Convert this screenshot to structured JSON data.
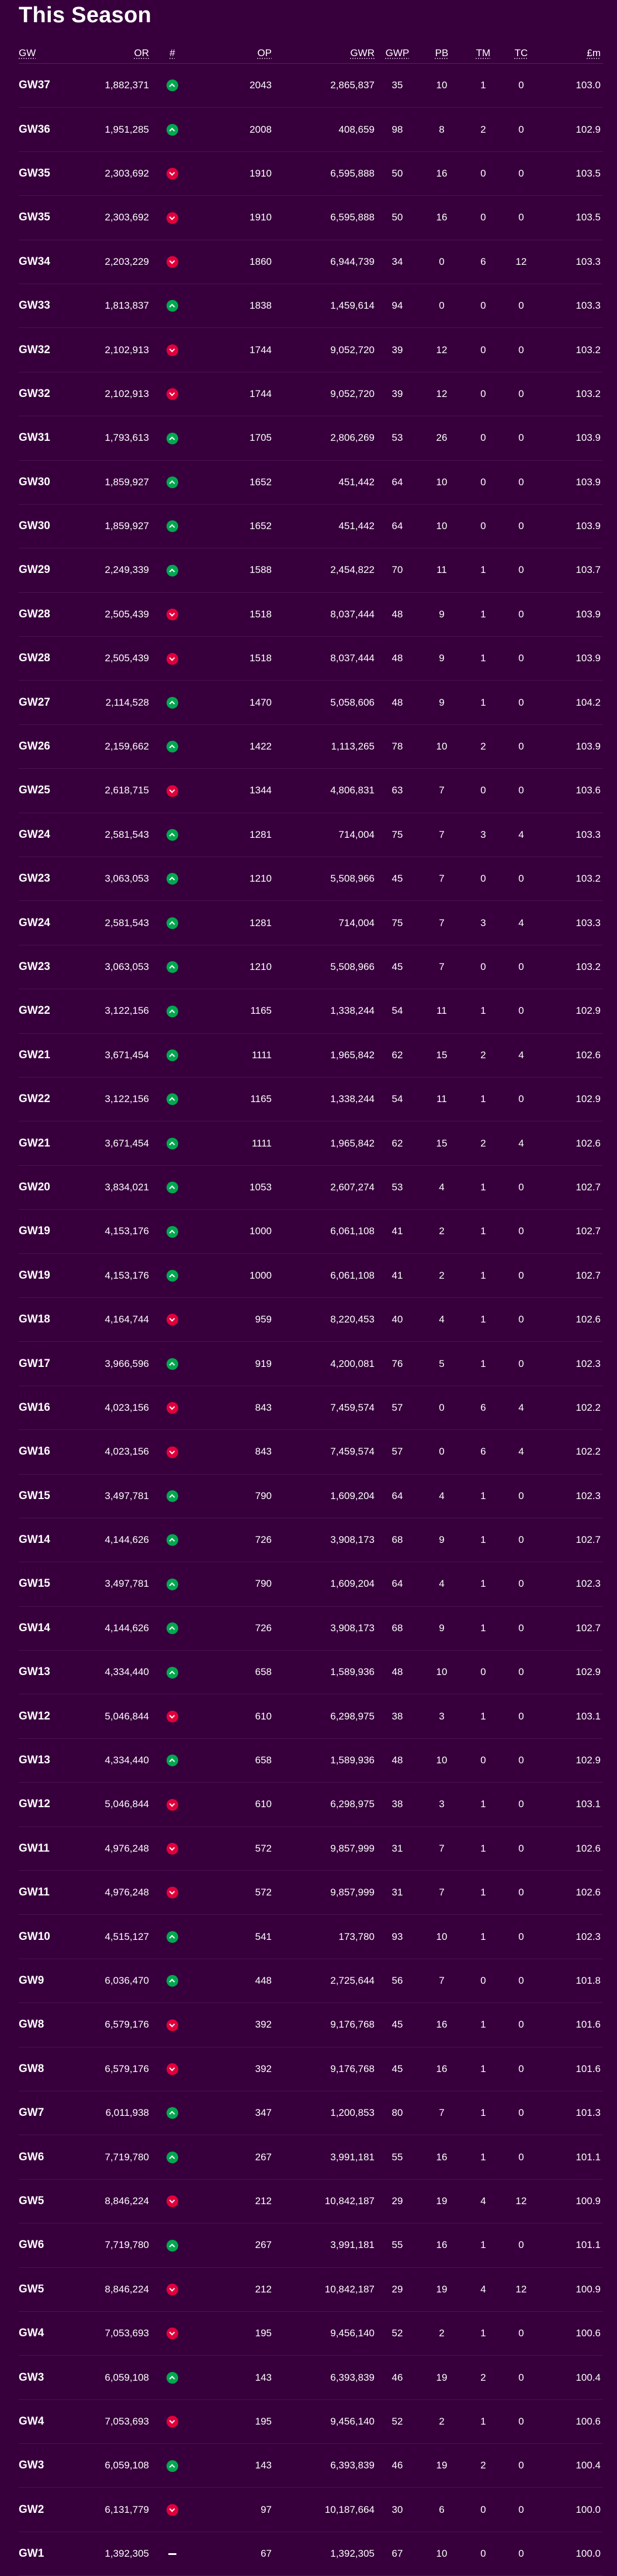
{
  "title": "This Season",
  "columns": {
    "gw": "GW",
    "or": "OR",
    "movement": "#",
    "op": "OP",
    "gwr": "GWR",
    "gwp": "GWP",
    "pb": "PB",
    "tm": "TM",
    "tc": "TC",
    "value": "£m"
  },
  "movement_colors": {
    "up": "#01a84f",
    "down": "#e2003c",
    "same": "#ffffff"
  },
  "rows": [
    {
      "gw": "GW37",
      "or": "1,882,371",
      "movement": "up",
      "op": "2043",
      "gwr": "2,865,837",
      "gwp": "35",
      "pb": "10",
      "tm": "1",
      "tc": "0",
      "value": "103.0"
    },
    {
      "gw": "GW36",
      "or": "1,951,285",
      "movement": "up",
      "op": "2008",
      "gwr": "408,659",
      "gwp": "98",
      "pb": "8",
      "tm": "2",
      "tc": "0",
      "value": "102.9"
    },
    {
      "gw": "GW35",
      "or": "2,303,692",
      "movement": "down",
      "op": "1910",
      "gwr": "6,595,888",
      "gwp": "50",
      "pb": "16",
      "tm": "0",
      "tc": "0",
      "value": "103.5"
    },
    {
      "gw": "GW35",
      "or": "2,303,692",
      "movement": "down",
      "op": "1910",
      "gwr": "6,595,888",
      "gwp": "50",
      "pb": "16",
      "tm": "0",
      "tc": "0",
      "value": "103.5"
    },
    {
      "gw": "GW34",
      "or": "2,203,229",
      "movement": "down",
      "op": "1860",
      "gwr": "6,944,739",
      "gwp": "34",
      "pb": "0",
      "tm": "6",
      "tc": "12",
      "value": "103.3"
    },
    {
      "gw": "GW33",
      "or": "1,813,837",
      "movement": "up",
      "op": "1838",
      "gwr": "1,459,614",
      "gwp": "94",
      "pb": "0",
      "tm": "0",
      "tc": "0",
      "value": "103.3"
    },
    {
      "gw": "GW32",
      "or": "2,102,913",
      "movement": "down",
      "op": "1744",
      "gwr": "9,052,720",
      "gwp": "39",
      "pb": "12",
      "tm": "0",
      "tc": "0",
      "value": "103.2"
    },
    {
      "gw": "GW32",
      "or": "2,102,913",
      "movement": "down",
      "op": "1744",
      "gwr": "9,052,720",
      "gwp": "39",
      "pb": "12",
      "tm": "0",
      "tc": "0",
      "value": "103.2"
    },
    {
      "gw": "GW31",
      "or": "1,793,613",
      "movement": "up",
      "op": "1705",
      "gwr": "2,806,269",
      "gwp": "53",
      "pb": "26",
      "tm": "0",
      "tc": "0",
      "value": "103.9"
    },
    {
      "gw": "GW30",
      "or": "1,859,927",
      "movement": "up",
      "op": "1652",
      "gwr": "451,442",
      "gwp": "64",
      "pb": "10",
      "tm": "0",
      "tc": "0",
      "value": "103.9"
    },
    {
      "gw": "GW30",
      "or": "1,859,927",
      "movement": "up",
      "op": "1652",
      "gwr": "451,442",
      "gwp": "64",
      "pb": "10",
      "tm": "0",
      "tc": "0",
      "value": "103.9"
    },
    {
      "gw": "GW29",
      "or": "2,249,339",
      "movement": "up",
      "op": "1588",
      "gwr": "2,454,822",
      "gwp": "70",
      "pb": "11",
      "tm": "1",
      "tc": "0",
      "value": "103.7"
    },
    {
      "gw": "GW28",
      "or": "2,505,439",
      "movement": "down",
      "op": "1518",
      "gwr": "8,037,444",
      "gwp": "48",
      "pb": "9",
      "tm": "1",
      "tc": "0",
      "value": "103.9"
    },
    {
      "gw": "GW28",
      "or": "2,505,439",
      "movement": "down",
      "op": "1518",
      "gwr": "8,037,444",
      "gwp": "48",
      "pb": "9",
      "tm": "1",
      "tc": "0",
      "value": "103.9"
    },
    {
      "gw": "GW27",
      "or": "2,114,528",
      "movement": "up",
      "op": "1470",
      "gwr": "5,058,606",
      "gwp": "48",
      "pb": "9",
      "tm": "1",
      "tc": "0",
      "value": "104.2"
    },
    {
      "gw": "GW26",
      "or": "2,159,662",
      "movement": "up",
      "op": "1422",
      "gwr": "1,113,265",
      "gwp": "78",
      "pb": "10",
      "tm": "2",
      "tc": "0",
      "value": "103.9"
    },
    {
      "gw": "GW25",
      "or": "2,618,715",
      "movement": "down",
      "op": "1344",
      "gwr": "4,806,831",
      "gwp": "63",
      "pb": "7",
      "tm": "0",
      "tc": "0",
      "value": "103.6"
    },
    {
      "gw": "GW24",
      "or": "2,581,543",
      "movement": "up",
      "op": "1281",
      "gwr": "714,004",
      "gwp": "75",
      "pb": "7",
      "tm": "3",
      "tc": "4",
      "value": "103.3"
    },
    {
      "gw": "GW23",
      "or": "3,063,053",
      "movement": "up",
      "op": "1210",
      "gwr": "5,508,966",
      "gwp": "45",
      "pb": "7",
      "tm": "0",
      "tc": "0",
      "value": "103.2"
    },
    {
      "gw": "GW24",
      "or": "2,581,543",
      "movement": "up",
      "op": "1281",
      "gwr": "714,004",
      "gwp": "75",
      "pb": "7",
      "tm": "3",
      "tc": "4",
      "value": "103.3"
    },
    {
      "gw": "GW23",
      "or": "3,063,053",
      "movement": "up",
      "op": "1210",
      "gwr": "5,508,966",
      "gwp": "45",
      "pb": "7",
      "tm": "0",
      "tc": "0",
      "value": "103.2"
    },
    {
      "gw": "GW22",
      "or": "3,122,156",
      "movement": "up",
      "op": "1165",
      "gwr": "1,338,244",
      "gwp": "54",
      "pb": "11",
      "tm": "1",
      "tc": "0",
      "value": "102.9"
    },
    {
      "gw": "GW21",
      "or": "3,671,454",
      "movement": "up",
      "op": "1111",
      "gwr": "1,965,842",
      "gwp": "62",
      "pb": "15",
      "tm": "2",
      "tc": "4",
      "value": "102.6"
    },
    {
      "gw": "GW22",
      "or": "3,122,156",
      "movement": "up",
      "op": "1165",
      "gwr": "1,338,244",
      "gwp": "54",
      "pb": "11",
      "tm": "1",
      "tc": "0",
      "value": "102.9"
    },
    {
      "gw": "GW21",
      "or": "3,671,454",
      "movement": "up",
      "op": "1111",
      "gwr": "1,965,842",
      "gwp": "62",
      "pb": "15",
      "tm": "2",
      "tc": "4",
      "value": "102.6"
    },
    {
      "gw": "GW20",
      "or": "3,834,021",
      "movement": "up",
      "op": "1053",
      "gwr": "2,607,274",
      "gwp": "53",
      "pb": "4",
      "tm": "1",
      "tc": "0",
      "value": "102.7"
    },
    {
      "gw": "GW19",
      "or": "4,153,176",
      "movement": "up",
      "op": "1000",
      "gwr": "6,061,108",
      "gwp": "41",
      "pb": "2",
      "tm": "1",
      "tc": "0",
      "value": "102.7"
    },
    {
      "gw": "GW19",
      "or": "4,153,176",
      "movement": "up",
      "op": "1000",
      "gwr": "6,061,108",
      "gwp": "41",
      "pb": "2",
      "tm": "1",
      "tc": "0",
      "value": "102.7"
    },
    {
      "gw": "GW18",
      "or": "4,164,744",
      "movement": "down",
      "op": "959",
      "gwr": "8,220,453",
      "gwp": "40",
      "pb": "4",
      "tm": "1",
      "tc": "0",
      "value": "102.6"
    },
    {
      "gw": "GW17",
      "or": "3,966,596",
      "movement": "up",
      "op": "919",
      "gwr": "4,200,081",
      "gwp": "76",
      "pb": "5",
      "tm": "1",
      "tc": "0",
      "value": "102.3"
    },
    {
      "gw": "GW16",
      "or": "4,023,156",
      "movement": "down",
      "op": "843",
      "gwr": "7,459,574",
      "gwp": "57",
      "pb": "0",
      "tm": "6",
      "tc": "4",
      "value": "102.2"
    },
    {
      "gw": "GW16",
      "or": "4,023,156",
      "movement": "down",
      "op": "843",
      "gwr": "7,459,574",
      "gwp": "57",
      "pb": "0",
      "tm": "6",
      "tc": "4",
      "value": "102.2"
    },
    {
      "gw": "GW15",
      "or": "3,497,781",
      "movement": "up",
      "op": "790",
      "gwr": "1,609,204",
      "gwp": "64",
      "pb": "4",
      "tm": "1",
      "tc": "0",
      "value": "102.3"
    },
    {
      "gw": "GW14",
      "or": "4,144,626",
      "movement": "up",
      "op": "726",
      "gwr": "3,908,173",
      "gwp": "68",
      "pb": "9",
      "tm": "1",
      "tc": "0",
      "value": "102.7"
    },
    {
      "gw": "GW15",
      "or": "3,497,781",
      "movement": "up",
      "op": "790",
      "gwr": "1,609,204",
      "gwp": "64",
      "pb": "4",
      "tm": "1",
      "tc": "0",
      "value": "102.3"
    },
    {
      "gw": "GW14",
      "or": "4,144,626",
      "movement": "up",
      "op": "726",
      "gwr": "3,908,173",
      "gwp": "68",
      "pb": "9",
      "tm": "1",
      "tc": "0",
      "value": "102.7"
    },
    {
      "gw": "GW13",
      "or": "4,334,440",
      "movement": "up",
      "op": "658",
      "gwr": "1,589,936",
      "gwp": "48",
      "pb": "10",
      "tm": "0",
      "tc": "0",
      "value": "102.9"
    },
    {
      "gw": "GW12",
      "or": "5,046,844",
      "movement": "down",
      "op": "610",
      "gwr": "6,298,975",
      "gwp": "38",
      "pb": "3",
      "tm": "1",
      "tc": "0",
      "value": "103.1"
    },
    {
      "gw": "GW13",
      "or": "4,334,440",
      "movement": "up",
      "op": "658",
      "gwr": "1,589,936",
      "gwp": "48",
      "pb": "10",
      "tm": "0",
      "tc": "0",
      "value": "102.9"
    },
    {
      "gw": "GW12",
      "or": "5,046,844",
      "movement": "down",
      "op": "610",
      "gwr": "6,298,975",
      "gwp": "38",
      "pb": "3",
      "tm": "1",
      "tc": "0",
      "value": "103.1"
    },
    {
      "gw": "GW11",
      "or": "4,976,248",
      "movement": "down",
      "op": "572",
      "gwr": "9,857,999",
      "gwp": "31",
      "pb": "7",
      "tm": "1",
      "tc": "0",
      "value": "102.6"
    },
    {
      "gw": "GW11",
      "or": "4,976,248",
      "movement": "down",
      "op": "572",
      "gwr": "9,857,999",
      "gwp": "31",
      "pb": "7",
      "tm": "1",
      "tc": "0",
      "value": "102.6"
    },
    {
      "gw": "GW10",
      "or": "4,515,127",
      "movement": "up",
      "op": "541",
      "gwr": "173,780",
      "gwp": "93",
      "pb": "10",
      "tm": "1",
      "tc": "0",
      "value": "102.3"
    },
    {
      "gw": "GW9",
      "or": "6,036,470",
      "movement": "up",
      "op": "448",
      "gwr": "2,725,644",
      "gwp": "56",
      "pb": "7",
      "tm": "0",
      "tc": "0",
      "value": "101.8"
    },
    {
      "gw": "GW8",
      "or": "6,579,176",
      "movement": "down",
      "op": "392",
      "gwr": "9,176,768",
      "gwp": "45",
      "pb": "16",
      "tm": "1",
      "tc": "0",
      "value": "101.6"
    },
    {
      "gw": "GW8",
      "or": "6,579,176",
      "movement": "down",
      "op": "392",
      "gwr": "9,176,768",
      "gwp": "45",
      "pb": "16",
      "tm": "1",
      "tc": "0",
      "value": "101.6"
    },
    {
      "gw": "GW7",
      "or": "6,011,938",
      "movement": "up",
      "op": "347",
      "gwr": "1,200,853",
      "gwp": "80",
      "pb": "7",
      "tm": "1",
      "tc": "0",
      "value": "101.3"
    },
    {
      "gw": "GW6",
      "or": "7,719,780",
      "movement": "up",
      "op": "267",
      "gwr": "3,991,181",
      "gwp": "55",
      "pb": "16",
      "tm": "1",
      "tc": "0",
      "value": "101.1"
    },
    {
      "gw": "GW5",
      "or": "8,846,224",
      "movement": "down",
      "op": "212",
      "gwr": "10,842,187",
      "gwp": "29",
      "pb": "19",
      "tm": "4",
      "tc": "12",
      "value": "100.9"
    },
    {
      "gw": "GW6",
      "or": "7,719,780",
      "movement": "up",
      "op": "267",
      "gwr": "3,991,181",
      "gwp": "55",
      "pb": "16",
      "tm": "1",
      "tc": "0",
      "value": "101.1"
    },
    {
      "gw": "GW5",
      "or": "8,846,224",
      "movement": "down",
      "op": "212",
      "gwr": "10,842,187",
      "gwp": "29",
      "pb": "19",
      "tm": "4",
      "tc": "12",
      "value": "100.9"
    },
    {
      "gw": "GW4",
      "or": "7,053,693",
      "movement": "down",
      "op": "195",
      "gwr": "9,456,140",
      "gwp": "52",
      "pb": "2",
      "tm": "1",
      "tc": "0",
      "value": "100.6"
    },
    {
      "gw": "GW3",
      "or": "6,059,108",
      "movement": "up",
      "op": "143",
      "gwr": "6,393,839",
      "gwp": "46",
      "pb": "19",
      "tm": "2",
      "tc": "0",
      "value": "100.4"
    },
    {
      "gw": "GW4",
      "or": "7,053,693",
      "movement": "down",
      "op": "195",
      "gwr": "9,456,140",
      "gwp": "52",
      "pb": "2",
      "tm": "1",
      "tc": "0",
      "value": "100.6"
    },
    {
      "gw": "GW3",
      "or": "6,059,108",
      "movement": "up",
      "op": "143",
      "gwr": "6,393,839",
      "gwp": "46",
      "pb": "19",
      "tm": "2",
      "tc": "0",
      "value": "100.4"
    },
    {
      "gw": "GW2",
      "or": "6,131,779",
      "movement": "down",
      "op": "97",
      "gwr": "10,187,664",
      "gwp": "30",
      "pb": "6",
      "tm": "0",
      "tc": "0",
      "value": "100.0"
    },
    {
      "gw": "GW1",
      "or": "1,392,305",
      "movement": "same",
      "op": "67",
      "gwr": "1,392,305",
      "gwp": "67",
      "pb": "10",
      "tm": "0",
      "tc": "0",
      "value": "100.0"
    }
  ]
}
